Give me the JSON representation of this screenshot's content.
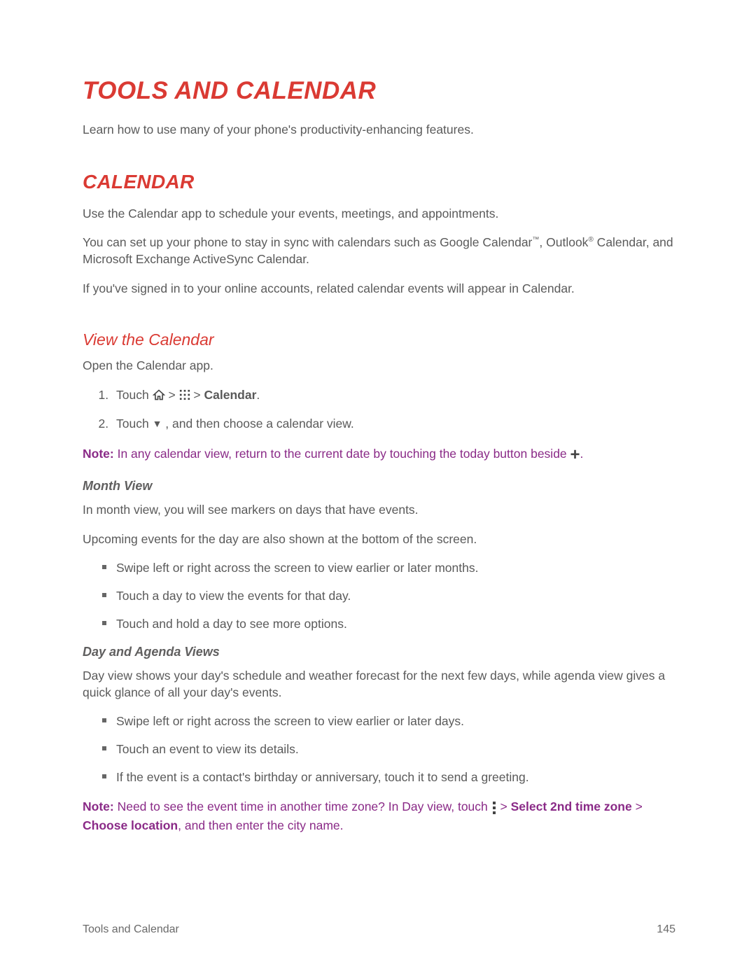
{
  "title": "TOOLS AND CALENDAR",
  "intro": "Learn how to use many of your phone's productivity-enhancing features.",
  "section": {
    "heading": "CALENDAR",
    "p1": "Use the Calendar app to schedule your events, meetings, and appointments.",
    "p2_a": "You can set up your phone to stay in sync with calendars such as Google Calendar",
    "p2_b": ", Outlook",
    "p2_c": " Calendar, and Microsoft Exchange ActiveSync Calendar.",
    "p3": "If you've signed in to your online accounts, related calendar events will appear in Calendar."
  },
  "view": {
    "heading": "View the Calendar",
    "open": "Open the Calendar app.",
    "step1_a": "Touch",
    "step1_b": "Calendar",
    "step2_a": "Touch ",
    "step2_b": ", and then choose a calendar view.",
    "note_label": "Note:",
    "note_text": "  In any calendar view, return to the current date by touching the today button beside "
  },
  "month": {
    "heading": "Month View",
    "p1": "In month view, you will see markers on days that have events.",
    "p2": "Upcoming events for the day are also shown at the bottom of the screen.",
    "li1": "Swipe left or right across the screen to view earlier or later months.",
    "li2": "Touch a day to view the events for that day.",
    "li3": "Touch and hold a day to see more options."
  },
  "day": {
    "heading": "Day and Agenda Views",
    "p1": "Day view shows your day's schedule and weather forecast for the next few days, while agenda view gives a quick glance of all your day's events.",
    "li1": "Swipe left or right across the screen to view earlier or later days.",
    "li2": "Touch an event to view its details.",
    "li3": "If the event is a contact's birthday or anniversary, touch it to send a greeting.",
    "note_label": "Note:",
    "note_a": "  Need to see the event time in another time zone? In Day view, touch",
    "note_b": "Select 2nd time zone ",
    "note_c": "Choose location",
    "note_d": ", and then enter the city name."
  },
  "footer": {
    "left": "Tools and Calendar",
    "right": "145"
  },
  "gt": " > "
}
